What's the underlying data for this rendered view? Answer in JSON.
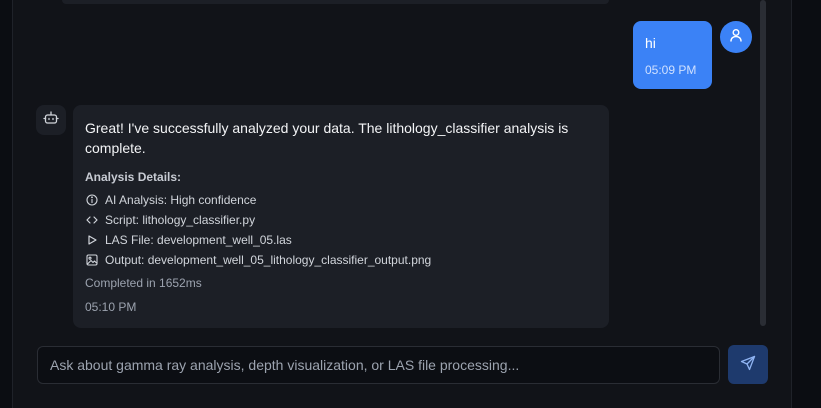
{
  "user_message": {
    "text": "hi",
    "time": "05:09 PM",
    "avatar_icon": "user-icon"
  },
  "bot_message": {
    "avatar_icon": "bot-icon",
    "text": "Great! I've successfully analyzed your data. The lithology_classifier analysis is complete.",
    "details_title": "Analysis Details:",
    "details": [
      {
        "icon": "info-circle-icon",
        "text": "AI Analysis: High confidence"
      },
      {
        "icon": "code-icon",
        "text": "Script: lithology_classifier.py"
      },
      {
        "icon": "play-icon",
        "text": "LAS File: development_well_05.las"
      },
      {
        "icon": "image-icon",
        "text": "Output: development_well_05_lithology_classifier_output.png"
      }
    ],
    "completed": "Completed in 1652ms",
    "time": "05:10 PM"
  },
  "composer": {
    "placeholder": "Ask about gamma ray analysis, depth visualization, or LAS file processing...",
    "value": "",
    "send_icon": "send-icon"
  },
  "colors": {
    "accent": "#3b82f6",
    "send_button": "#1e3a6d",
    "bubble": "#1c1f26",
    "background": "#111318"
  }
}
